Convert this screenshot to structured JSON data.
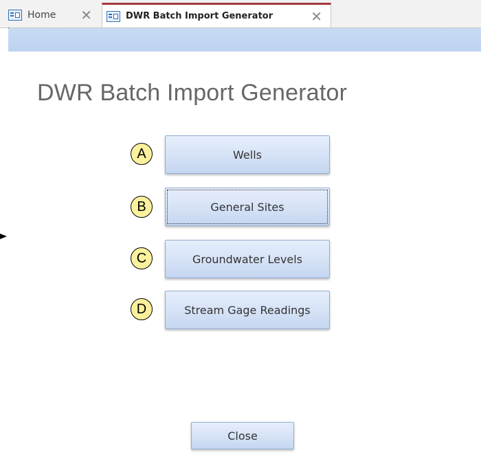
{
  "tabs": [
    {
      "label": "Home",
      "icon": "form-icon",
      "active": false
    },
    {
      "label": "DWR Batch Import Generator",
      "icon": "form-icon",
      "active": true
    }
  ],
  "tab_close_glyph": "✕",
  "form": {
    "title": "DWR Batch Import Generator",
    "buttons": [
      {
        "label": "Wells",
        "marker": "A"
      },
      {
        "label": "General Sites",
        "marker": "B",
        "focused": true
      },
      {
        "label": "Groundwater Levels",
        "marker": "C"
      },
      {
        "label": "Stream Gage Readings",
        "marker": "D"
      }
    ],
    "close_label": "Close"
  },
  "colors": {
    "header_band": "#c8dbf3",
    "active_tab_accent": "#a4373a",
    "marker_fill": "#fbf19c"
  }
}
